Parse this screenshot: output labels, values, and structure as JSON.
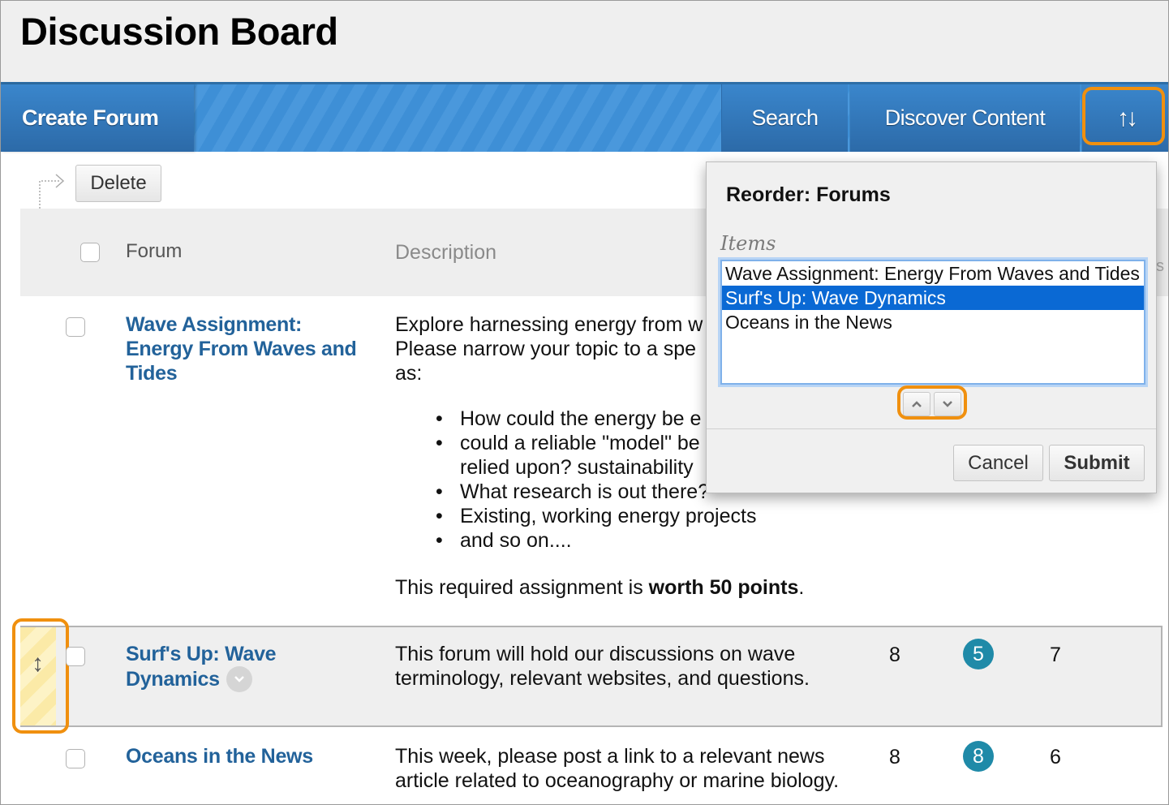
{
  "page": {
    "title": "Discussion Board"
  },
  "action_bar": {
    "create_forum": "Create Forum",
    "search": "Search",
    "discover_content": "Discover Content",
    "reorder_icon": "reorder-arrows-icon",
    "reorder_glyph": "↑↓"
  },
  "list_actions": {
    "delete": "Delete"
  },
  "table": {
    "headers": {
      "forum": "Forum",
      "description": "Description"
    },
    "rows": [
      {
        "forum": "Wave Assignment: Energy From Waves and Tides",
        "forum_lines": [
          "Wave Assignment:",
          "Energy From Waves and",
          "Tides"
        ],
        "description_lines": [
          "Explore harnessing energy from w",
          "Please narrow your topic to a spe",
          "as:"
        ],
        "bullets": [
          "How could the energy be e",
          "could a reliable \"model\" be",
          "relied upon? sustainability",
          "What research is out there?",
          "Existing, working energy projects",
          "and so on...."
        ],
        "note_prefix": "This required assignment is ",
        "note_bold": "worth 50 points",
        "note_suffix": "."
      },
      {
        "forum_lines": [
          "Surf's Up: Wave",
          "Dynamics"
        ],
        "description_lines": [
          "This forum will hold our discussions on wave",
          "terminology, relevant websites, and questions."
        ],
        "posts": "8",
        "unread": "5",
        "participants": "7",
        "selected": true
      },
      {
        "forum_lines": [
          "Oceans in the News"
        ],
        "description_lines": [
          "This week, please post a link to a relevant news",
          "article related to oceanography or marine biology."
        ],
        "posts": "8",
        "unread": "8",
        "participants": "6"
      }
    ]
  },
  "reorder_dialog": {
    "title": "Reorder: Forums",
    "items_label": "Items",
    "items": [
      "Wave Assignment: Energy From Waves and Tides",
      "Surf's Up: Wave Dynamics",
      "Oceans in the News"
    ],
    "selected_index": 1,
    "move_up": "move-up-icon",
    "move_down": "move-down-icon",
    "cancel": "Cancel",
    "submit": "Submit"
  },
  "colors": {
    "action_bar": "#3a86cc",
    "link": "#22629a",
    "highlight": "#f0900f",
    "badge": "#1f8aa8",
    "selection": "#0a69d4"
  }
}
